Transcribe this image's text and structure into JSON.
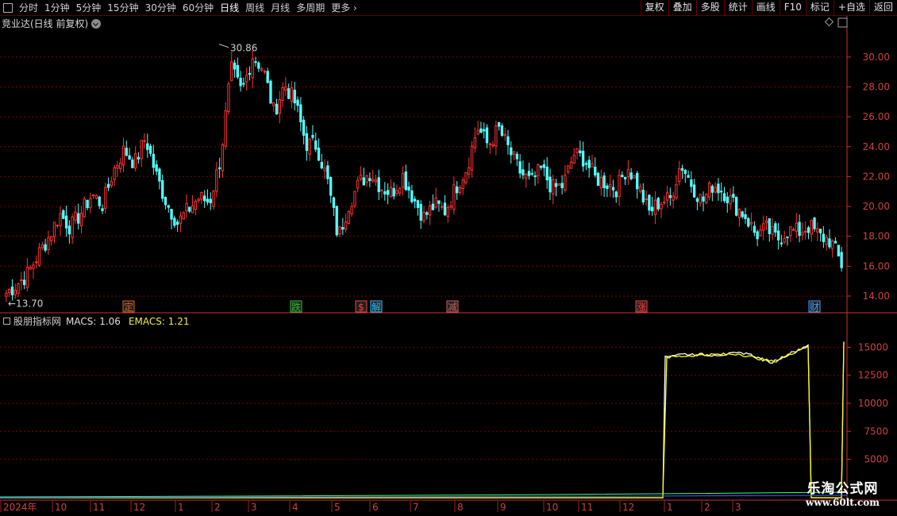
{
  "toolbar": {
    "periods": [
      "分时",
      "1分钟",
      "5分钟",
      "15分钟",
      "30分钟",
      "60分钟",
      "日线",
      "周线",
      "月线",
      "多周期",
      "更多"
    ],
    "active_index": 6,
    "buttons": [
      "复权",
      "叠加",
      "多股",
      "统计",
      "画线",
      "F10",
      "标记",
      "+自选",
      "返回"
    ]
  },
  "main_title": "竞业达(日线 前复权)",
  "indicator": {
    "name": "股朋指标网",
    "macs_label": "MACS: 1.06",
    "emacs_label": "EMACS: 1.21"
  },
  "watermark": {
    "line1": "乐淘公式网",
    "line2": "www.60lt.com"
  },
  "colors": {
    "up": "#ff3232",
    "down": "#54ffff",
    "grid": "#7a0000",
    "axis": "#c83232",
    "macs": "#ffffff",
    "emacs": "#ffff00"
  },
  "chart_data": [
    {
      "type": "candlestick",
      "ylim": [
        13.2,
        31.8
      ],
      "yticks": [
        14.0,
        16.0,
        18.0,
        20.0,
        22.0,
        24.0,
        26.0,
        28.0,
        30.0
      ],
      "high_label": "30.86",
      "low_label": "13.70",
      "annotation_markers": [
        "定",
        "跌",
        "$",
        "解",
        "减",
        "涨",
        "财"
      ],
      "close_path": [
        14.2,
        14.8,
        15.5,
        16.8,
        18.0,
        19.5,
        18.6,
        19.6,
        20.8,
        20.1,
        22.4,
        23.8,
        22.9,
        24.6,
        22.1,
        20.2,
        18.9,
        19.8,
        20.6,
        20.3,
        23.2,
        29.2,
        27.6,
        30.1,
        29.2,
        26.3,
        28.2,
        26.9,
        24.2,
        24.1,
        21.7,
        17.9,
        20.2,
        21.6,
        22.3,
        21.3,
        20.9,
        22.1,
        20.6,
        19.3,
        20.1,
        19.7,
        21.3,
        22.6,
        25.3,
        24.1,
        25.2,
        23.7,
        22.3,
        21.6,
        22.5,
        21.2,
        21.4,
        23.5,
        23.2,
        21.9,
        21.6,
        21.2,
        22.7,
        21.4,
        19.6,
        20.3,
        20.5,
        22.9,
        21.5,
        20.3,
        21.5,
        21.0,
        20.1,
        19.4,
        18.1,
        18.5,
        17.8,
        18.4,
        18.3,
        18.7,
        18.0,
        17.7,
        16.1
      ],
      "x_labels": [
        "2024年",
        "10",
        "11",
        "12",
        "1",
        "2",
        "3",
        "4",
        "5",
        "6",
        "7",
        "8",
        "9",
        "10",
        "11",
        "12",
        "1",
        "2",
        "3"
      ]
    },
    {
      "type": "line",
      "ylim": [
        1500,
        16800
      ],
      "yticks": [
        5000,
        7500,
        10000,
        12500,
        15000
      ],
      "series": [
        {
          "name": "MACS",
          "path": [
            [
              0,
              0
            ],
            [
              835,
              0
            ],
            [
              838,
              14200
            ],
            [
              860,
              14400
            ],
            [
              900,
              14300
            ],
            [
              940,
              14500
            ],
            [
              970,
              13600
            ],
            [
              1000,
              14600
            ],
            [
              1018,
              15200
            ],
            [
              1022,
              0
            ],
            [
              1060,
              0
            ],
            [
              1063,
              15500
            ]
          ]
        },
        {
          "name": "EMACS",
          "path": [
            [
              0,
              0
            ],
            [
              835,
              0
            ],
            [
              840,
              14100
            ],
            [
              880,
              14300
            ],
            [
              930,
              14400
            ],
            [
              975,
              13700
            ],
            [
              1005,
              14700
            ],
            [
              1018,
              15100
            ],
            [
              1022,
              0
            ],
            [
              1060,
              0
            ],
            [
              1063,
              15400
            ]
          ]
        }
      ]
    }
  ]
}
